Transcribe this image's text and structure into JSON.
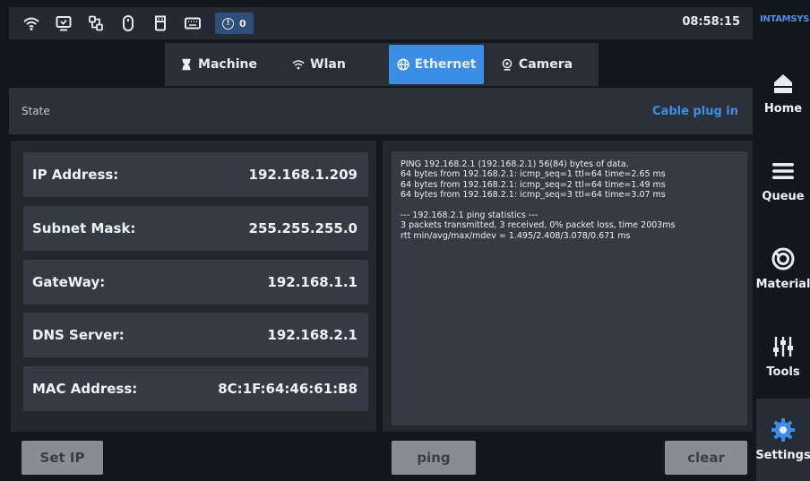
{
  "statusbar": {
    "icons": [
      "wifi-icon",
      "monitor-icon",
      "network-icon",
      "mouse-icon",
      "usb-storage-icon",
      "keyboard-icon"
    ],
    "alert_badge": {
      "icon": "alert-circle-icon",
      "count": "0"
    },
    "clock": "08:58:15"
  },
  "brand": "INTAMSYS",
  "tabs": [
    {
      "label": "Machine",
      "icon": "hourglass-icon",
      "active": false
    },
    {
      "label": "Wlan",
      "icon": "wifi-icon",
      "active": false
    },
    {
      "label": "Ethernet",
      "icon": "globe-icon",
      "active": true
    },
    {
      "label": "Camera",
      "icon": "camera-icon",
      "active": false
    }
  ],
  "state": {
    "label": "State",
    "value": "Cable plug in"
  },
  "network": [
    {
      "key": "IP Address:",
      "value": "192.168.1.209"
    },
    {
      "key": "Subnet Mask:",
      "value": "255.255.255.0"
    },
    {
      "key": "GateWay:",
      "value": "192.168.1.1"
    },
    {
      "key": "DNS Server:",
      "value": "192.168.2.1"
    },
    {
      "key": "MAC Address:",
      "value": "8C:1F:64:46:61:B8"
    }
  ],
  "console_lines": [
    "PING 192.168.2.1 (192.168.2.1) 56(84) bytes of data.",
    "64 bytes from 192.168.2.1: icmp_seq=1 ttl=64 time=2.65 ms",
    "64 bytes from 192.168.2.1: icmp_seq=2 ttl=64 time=1.49 ms",
    "64 bytes from 192.168.2.1: icmp_seq=3 ttl=64 time=3.07 ms",
    "",
    "--- 192.168.2.1 ping statistics ---",
    "3 packets transmitted, 3 received, 0% packet loss, time 2003ms",
    "rtt min/avg/max/mdev = 1.495/2.408/3.078/0.671 ms"
  ],
  "buttons": {
    "set_ip": "Set IP",
    "ping": "ping",
    "clear": "clear"
  },
  "sidenav": [
    {
      "label": "Home",
      "icon": "home-icon",
      "active": false
    },
    {
      "label": "Queue",
      "icon": "menu-icon",
      "active": false
    },
    {
      "label": "Material",
      "icon": "spool-icon",
      "active": false
    },
    {
      "label": "Tools",
      "icon": "sliders-icon",
      "active": false
    },
    {
      "label": "Settings",
      "icon": "gear-icon",
      "active": true
    }
  ],
  "colors": {
    "accent": "#3a8ee6",
    "background": "#12161d",
    "panel": "#23282f",
    "row": "#353b44",
    "button": "#8a8e94"
  }
}
